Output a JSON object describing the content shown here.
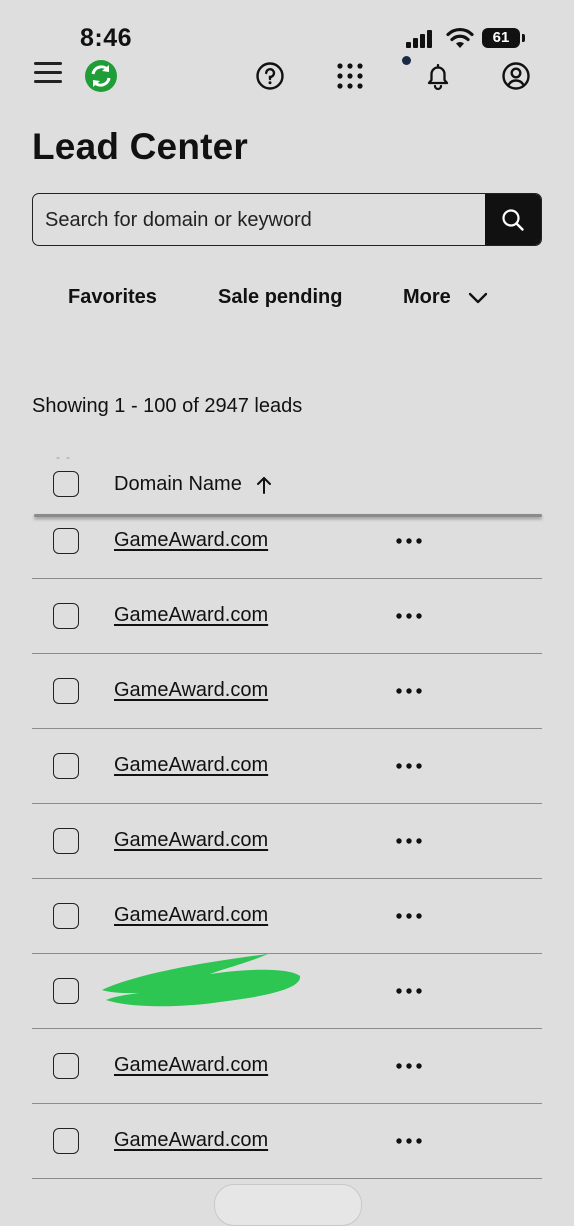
{
  "status_bar": {
    "time": "8:46",
    "battery": "61",
    "icons": [
      "signal-icon",
      "wifi-icon",
      "battery-icon"
    ]
  },
  "header": {
    "icons": [
      "menu-icon",
      "app-logo",
      "help-icon",
      "apps-grid-icon",
      "bell-icon",
      "account-icon"
    ],
    "logo_color": "#1f9d37"
  },
  "page": {
    "title": "Lead Center"
  },
  "search": {
    "placeholder": "Search for domain or keyword",
    "value": ""
  },
  "filters": {
    "favorites": "Favorites",
    "sale_pending": "Sale pending",
    "more": "More"
  },
  "results": {
    "summary": "Showing 1 - 100 of 2947 leads"
  },
  "table": {
    "column_header": "Domain Name",
    "sort": "ascending",
    "rows": [
      {
        "domain": "GameAward.com"
      },
      {
        "domain": "GameAward.com"
      },
      {
        "domain": "GameAward.com"
      },
      {
        "domain": "GameAward.com"
      },
      {
        "domain": "GameAward.com"
      },
      {
        "domain": "GameAward.com"
      },
      {
        "domain": "",
        "redacted": true
      },
      {
        "domain": "GameAward.com"
      },
      {
        "domain": "GameAward.com"
      }
    ]
  },
  "colors": {
    "background": "#dedede",
    "text": "#111111",
    "search_button": "#111111",
    "redaction": "#2dc653"
  }
}
